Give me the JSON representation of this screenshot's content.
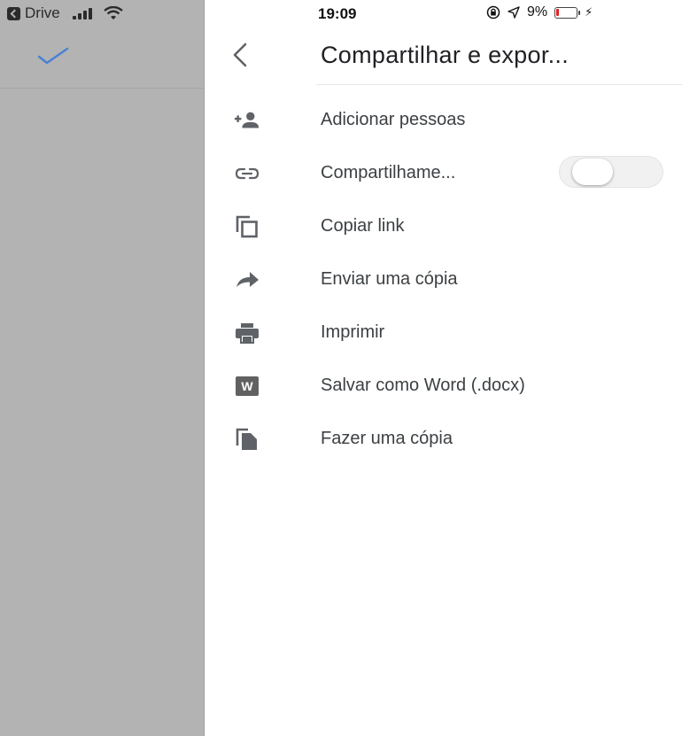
{
  "status": {
    "back_app": "Drive",
    "time": "19:09",
    "battery_text": "9%"
  },
  "header": {
    "title": "Compartilhar e expor..."
  },
  "menu": [
    {
      "label": "Adicionar pessoas",
      "icon": "add-person-icon"
    },
    {
      "label": "Compartilhame...",
      "icon": "link-icon",
      "toggle": false
    },
    {
      "label": "Copiar link",
      "icon": "copy-icon"
    },
    {
      "label": "Enviar uma cópia",
      "icon": "share-arrow-icon"
    },
    {
      "label": "Imprimir",
      "icon": "print-icon"
    },
    {
      "label": "Salvar como Word (.docx)",
      "icon": "word-icon"
    },
    {
      "label": "Fazer uma cópia",
      "icon": "file-copy-icon"
    }
  ],
  "word_icon_letter": "W",
  "colors": {
    "overlay": "#b3b3b3",
    "check": "#4a7fd6",
    "icon": "#5f6368",
    "battery": "#e02020"
  }
}
